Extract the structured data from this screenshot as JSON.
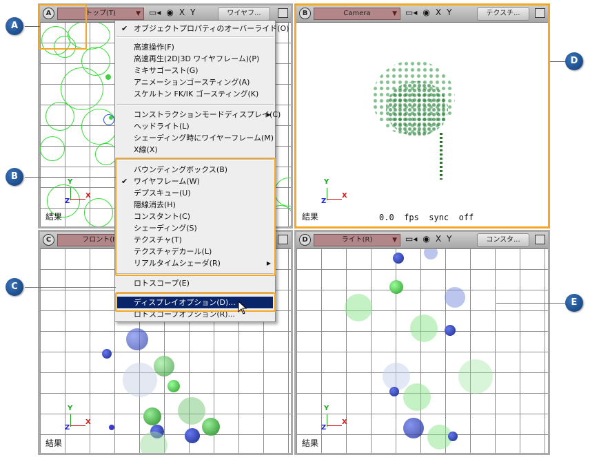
{
  "viewports": {
    "A": {
      "letter": "A",
      "camera": "トップ(T)",
      "button": "ワイヤフ...",
      "result": "結果"
    },
    "B": {
      "letter": "B",
      "camera": "Camera",
      "button": "テクスチ...",
      "result": "結果",
      "fps": "0.0  fps  sync  off"
    },
    "C": {
      "letter": "C",
      "camera": "フロント(F)",
      "result": "結果"
    },
    "D": {
      "letter": "D",
      "camera": "ライト(R)",
      "button": "コンスタ...",
      "result": "結果"
    }
  },
  "toolbar_icons": {
    "camera_icon": "▭◂",
    "eye_icon": "◉",
    "x_label": "X",
    "y_label": "Y"
  },
  "axis_labels": {
    "x": "X",
    "y": "Y",
    "z": "Z"
  },
  "menu": {
    "override": "オブジェクトプロパティのオーバーライド(O)",
    "items1": [
      "高速操作(F)",
      "高速再生(2D|3D ワイヤフレーム)(P)",
      "ミキサゴースト(G)",
      "アニメーションゴースティング(A)",
      "スケルトン FK/IK ゴースティング(K)"
    ],
    "items2": [
      "コンストラクションモードディスプレイ(C)",
      "ヘッドライト(L)",
      "シェーディング時にワイヤーフレーム(M)",
      "X線(X)"
    ],
    "items3": [
      "バウンディングボックス(B)",
      "ワイヤフレーム(W)",
      "デプスキュー(U)",
      "隠線消去(H)",
      "コンスタント(C)",
      "シェーディング(S)",
      "テクスチャ(T)",
      "テクスチャデカール(L)",
      "リアルタイムシェーダ(R)"
    ],
    "rotoscope": "ロトスコープ(E)",
    "display_options": "ディスプレイオプション(D)...",
    "rotoscope_options": "ロトスコープオプション(R)..."
  },
  "callouts": {
    "a": "A",
    "b": "B",
    "c": "C",
    "d": "D",
    "e": "E"
  },
  "colors": {
    "highlight": "#f5a623",
    "menu_selected": "#0a246a",
    "callout": "#1f5aa0",
    "camera_field": "#b3878a"
  }
}
